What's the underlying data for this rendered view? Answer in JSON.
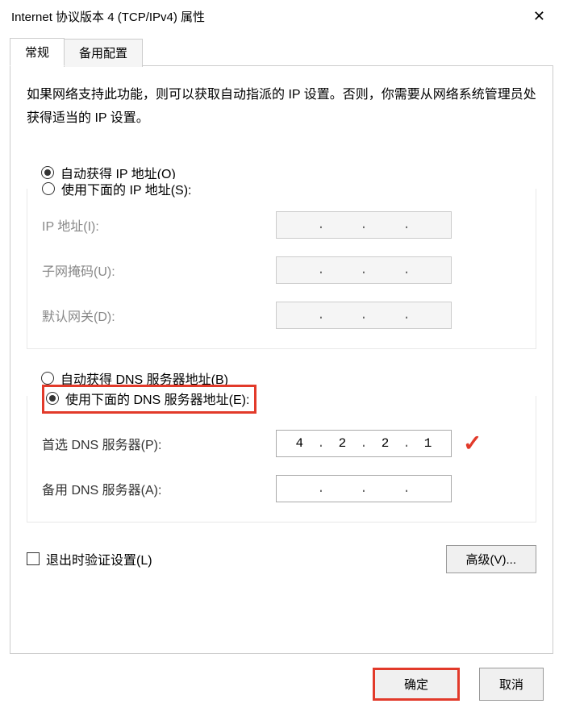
{
  "window": {
    "title": "Internet 协议版本 4 (TCP/IPv4) 属性"
  },
  "tabs": {
    "general": "常规",
    "alternate": "备用配置"
  },
  "description": "如果网络支持此功能，则可以获取自动指派的 IP 设置。否则，你需要从网络系统管理员处获得适当的 IP 设置。",
  "ip_section": {
    "auto_label": "自动获得 IP 地址(O)",
    "manual_label": "使用下面的 IP 地址(S):",
    "selected": "auto",
    "fields": {
      "ip": "IP 地址(I):",
      "subnet": "子网掩码(U):",
      "gateway": "默认网关(D):"
    }
  },
  "dns_section": {
    "auto_label": "自动获得 DNS 服务器地址(B)",
    "manual_label": "使用下面的 DNS 服务器地址(E):",
    "selected": "manual",
    "fields": {
      "preferred": "首选 DNS 服务器(P):",
      "alternate": "备用 DNS 服务器(A):"
    },
    "preferred_value": [
      "4",
      "2",
      "2",
      "1"
    ],
    "alternate_value": [
      "",
      "",
      "",
      ""
    ]
  },
  "validate_checkbox": "退出时验证设置(L)",
  "buttons": {
    "advanced": "高级(V)...",
    "ok": "确定",
    "cancel": "取消"
  },
  "annotations": {
    "checkmark": "✓"
  }
}
